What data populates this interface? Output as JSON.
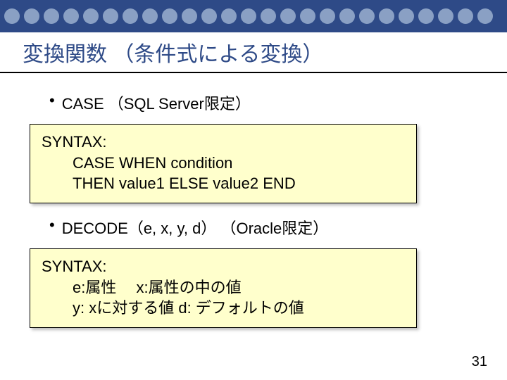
{
  "title": "変換関数 （条件式による変換）",
  "bullets": [
    "CASE （SQL Server限定）",
    "DECODE（e, x, y, d） （Oracle限定）"
  ],
  "box1": {
    "l1": "SYNTAX:",
    "l2": "CASE WHEN condition",
    "l3": "THEN value1 ELSE value2 END"
  },
  "box2": {
    "l1": "SYNTAX:",
    "l2": "e:属性　 x:属性の中の値",
    "l3": "y: xに対する値  d: デフォルトの値"
  },
  "pageNumber": "31"
}
